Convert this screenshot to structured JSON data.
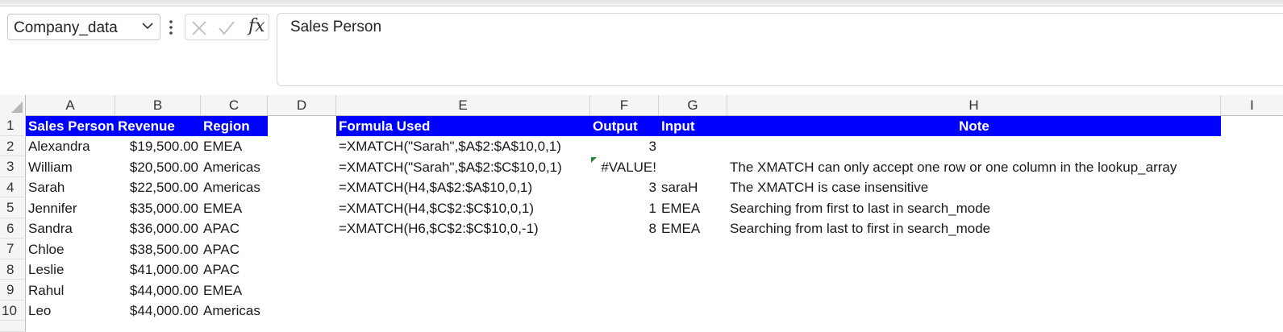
{
  "namebox": {
    "value": "Company_data"
  },
  "formula_bar": {
    "content": "Sales Person",
    "fx": "fx"
  },
  "columns": [
    "A",
    "B",
    "C",
    "D",
    "E",
    "F",
    "G",
    "H",
    "I"
  ],
  "rows": [
    "1",
    "2",
    "3",
    "4",
    "5",
    "6",
    "7",
    "8",
    "9",
    "10"
  ],
  "header": {
    "a": "Sales Person",
    "b": "Revenue",
    "c": "Region",
    "e": "Formula Used",
    "f": "Output",
    "g": "Input",
    "h": "Note"
  },
  "data": [
    {
      "name": "Alexandra",
      "revenue": "$19,500.00",
      "region": "EMEA"
    },
    {
      "name": "William",
      "revenue": "$20,500.00",
      "region": "Americas"
    },
    {
      "name": "Sarah",
      "revenue": "$22,500.00",
      "region": "Americas"
    },
    {
      "name": "Jennifer",
      "revenue": "$35,000.00",
      "region": "EMEA"
    },
    {
      "name": "Sandra",
      "revenue": "$36,000.00",
      "region": "APAC"
    },
    {
      "name": "Chloe",
      "revenue": "$38,500.00",
      "region": "APAC"
    },
    {
      "name": "Leslie",
      "revenue": "$41,000.00",
      "region": "APAC"
    },
    {
      "name": "Rahul",
      "revenue": "$44,000.00",
      "region": "EMEA"
    },
    {
      "name": "Leo",
      "revenue": "$44,000.00",
      "region": "Americas"
    }
  ],
  "formulas": [
    {
      "formula": "=XMATCH(\"Sarah\",$A$2:$A$10,0,1)",
      "output": "3",
      "input": "",
      "note": ""
    },
    {
      "formula": "=XMATCH(\"Sarah\",$A$2:$C$10,0,1)",
      "output": "#VALUE!",
      "input": "",
      "note": "The XMATCH can only accept one row or one column in the lookup_array"
    },
    {
      "formula": "=XMATCH(H4,$A$2:$A$10,0,1)",
      "output": "3",
      "input": "saraH",
      "note": "The XMATCH is case insensitive"
    },
    {
      "formula": "=XMATCH(H4,$C$2:$C$10,0,1)",
      "output": "1",
      "input": "EMEA",
      "note": "Searching from first to last in search_mode"
    },
    {
      "formula": "=XMATCH(H6,$C$2:$C$10,0,-1)",
      "output": "8",
      "input": "EMEA",
      "note": "Searching from last to first in search_mode"
    }
  ],
  "colors": {
    "header_fill": "#0000ff",
    "header_text": "#ffffff",
    "error_indicator": "#1e8a3a"
  },
  "icons": [
    "chevron-down-icon",
    "more-options-icon",
    "cancel-icon",
    "enter-check-icon",
    "insert-function-icon",
    "select-all-triangle-icon"
  ]
}
